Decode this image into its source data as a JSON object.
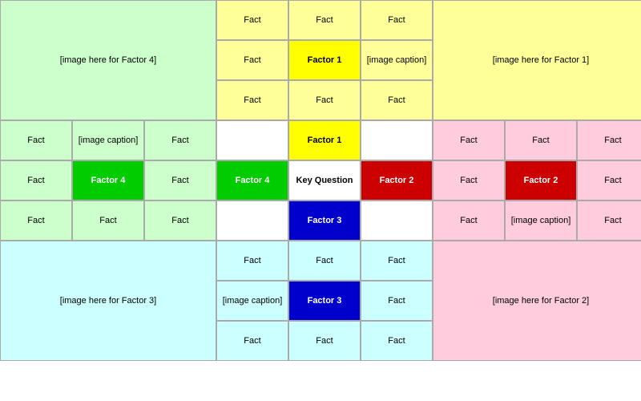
{
  "cells": {
    "fact": "Fact",
    "factor1": "Factor 1",
    "factor2": "Factor 2",
    "factor3": "Factor 3",
    "factor4": "Factor 4",
    "keyQuestion": "Key Question",
    "imageCaption": "[image caption]",
    "imageForFactor1": "[image here for Factor 1]",
    "imageForFactor2": "[image here for Factor 2]",
    "imageForFactor3": "[image here for Factor 3]",
    "imageForFactor4": "[image here for Factor 4]"
  }
}
